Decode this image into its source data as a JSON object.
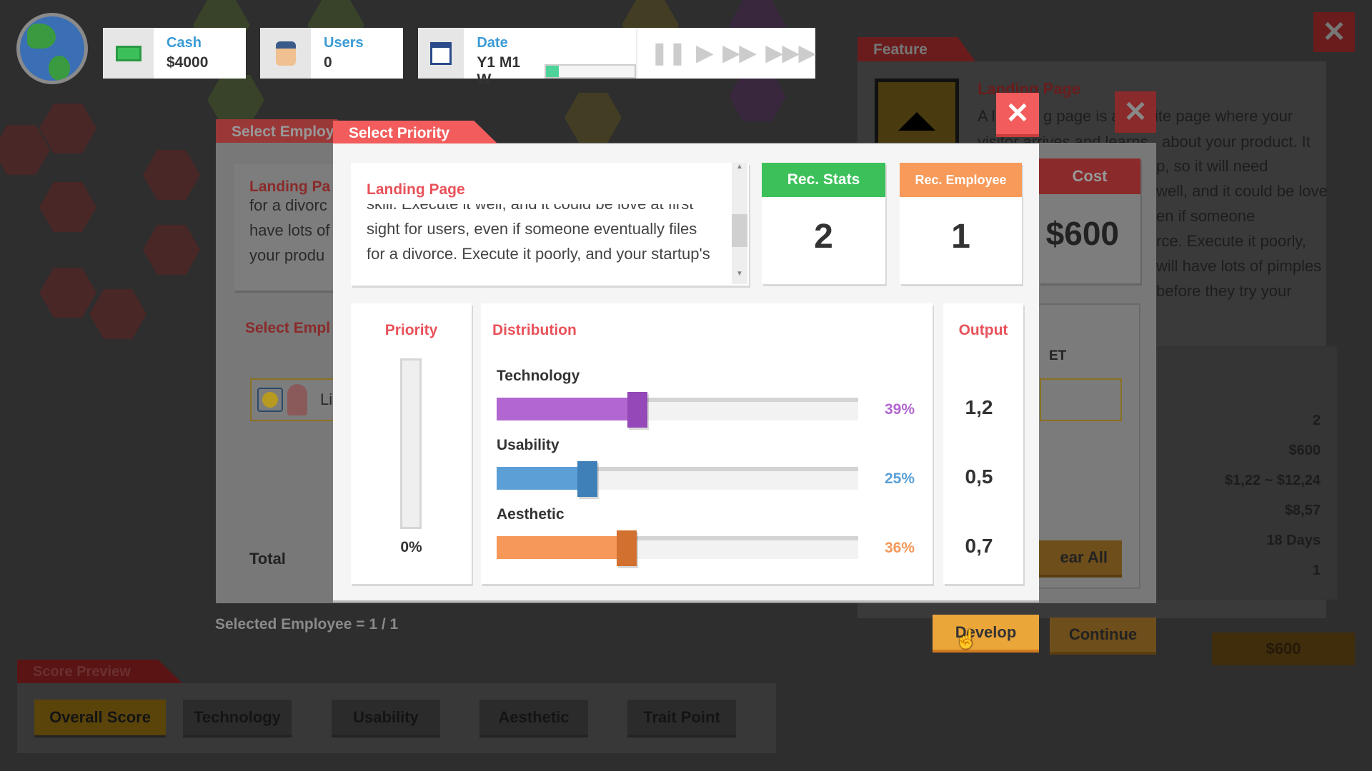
{
  "topbar": {
    "cash": {
      "label": "Cash",
      "value": "$4000",
      "icon": "cash-icon"
    },
    "users": {
      "label": "Users",
      "value": "0",
      "icon": "user-avatar-icon"
    },
    "date": {
      "label": "Date",
      "value": "Y1 M1 W",
      "progress": 0.15,
      "icon": "calendar-icon"
    },
    "speed_controls": [
      "pause-icon",
      "play-icon",
      "fast-forward-icon",
      "fastest-forward-icon"
    ]
  },
  "background": {
    "employee_panel": {
      "tab": "Select Employ",
      "feature_title": "Landing Pa",
      "text_lines": [
        "for a divorc",
        "have lots of",
        "your produ"
      ],
      "select_label": "Select Empl",
      "employee_name": "Li",
      "total_label": "Total",
      "selected_count": "Selected Employee = 1 / 1"
    },
    "cost_panel": {
      "header": "Cost",
      "value": "$600",
      "et_label": "ET",
      "clear_all": "ear All"
    },
    "feature_panel": {
      "tab": "Feature",
      "title": "Landing Page",
      "text_lines": [
        "A l",
        "g page is a",
        "ite page where your",
        "visitor arrives and learns",
        "about your product. It",
        "p, so it will need",
        "well, and it could be love",
        "en if someone",
        "rce. Execute it poorly,",
        "will have lots of pimples",
        "before they try your"
      ],
      "summary_values": [
        "2",
        "$600",
        "$1,22 ~ $12,24",
        "$8,57",
        "18 Days",
        "1"
      ]
    },
    "buttons": {
      "develop": "Develop",
      "continue": "Continue",
      "price": "$600"
    },
    "score_preview": {
      "tab": "Score Preview",
      "buttons": [
        "Overall Score",
        "Technology",
        "Usability",
        "Aesthetic",
        "Trait Point"
      ]
    }
  },
  "modal": {
    "tab": "Select Priority",
    "description": {
      "title": "Landing Page",
      "lines": [
        "skill. Execute it well, and it could be love at first",
        "sight for users, even if someone eventually files",
        "for a divorce. Execute it poorly, and your startup's"
      ]
    },
    "rec_stats": {
      "label": "Rec. Stats",
      "value": "2"
    },
    "rec_employee": {
      "label": "Rec. Employee",
      "value": "1"
    },
    "priority": {
      "label": "Priority",
      "value": "0%",
      "level": 0
    },
    "distribution": {
      "label": "Distribution",
      "items": [
        {
          "name": "Technology",
          "percent": "39%",
          "fraction": 0.39,
          "color": "#b266d0",
          "thumb": "#9548b8"
        },
        {
          "name": "Usability",
          "percent": "25%",
          "fraction": 0.25,
          "color": "#5b9fd6",
          "thumb": "#3f80b8"
        },
        {
          "name": "Aesthetic",
          "percent": "36%",
          "fraction": 0.36,
          "color": "#f5985a",
          "thumb": "#d2702f"
        }
      ]
    },
    "output": {
      "label": "Output",
      "values": [
        "1,2",
        "0,5",
        "0,7"
      ]
    }
  },
  "colors": {
    "accent_red": "#f25c5c",
    "rec_stats_green": "#3cc15a",
    "rec_employee_orange": "#f79a5a",
    "develop_yellow": "#eba63a",
    "label_blue": "#3a9bd5"
  }
}
